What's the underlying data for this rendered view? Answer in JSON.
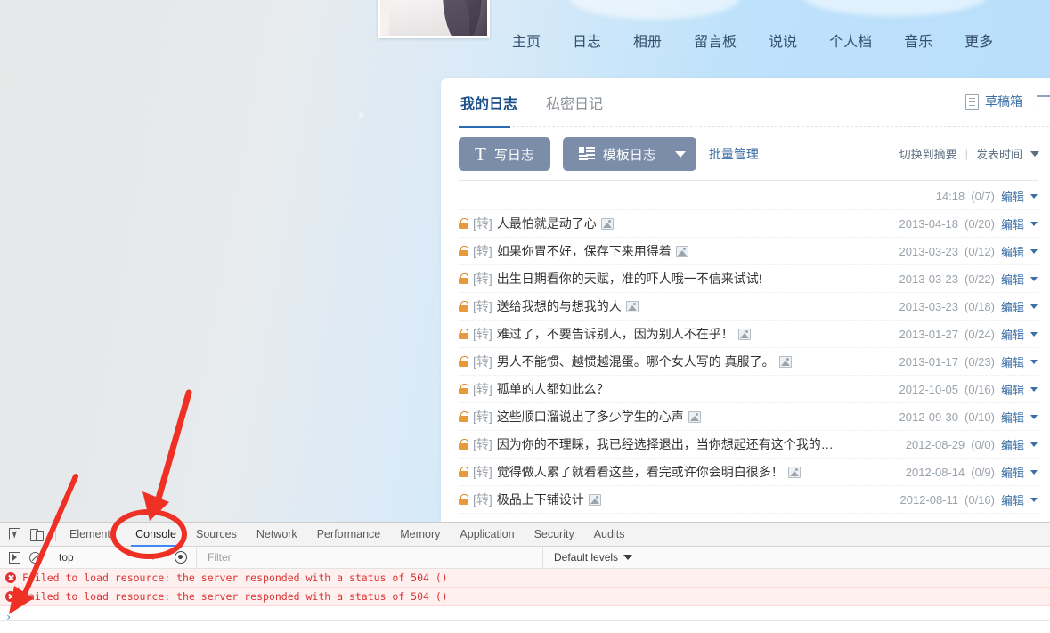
{
  "site": {
    "nav": [
      {
        "label": "主页",
        "name": "nav-home"
      },
      {
        "label": "日志",
        "name": "nav-blog"
      },
      {
        "label": "相册",
        "name": "nav-album"
      },
      {
        "label": "留言板",
        "name": "nav-guestbook"
      },
      {
        "label": "说说",
        "name": "nav-shuoshuo"
      },
      {
        "label": "个人档",
        "name": "nav-profile"
      },
      {
        "label": "音乐",
        "name": "nav-music"
      },
      {
        "label": "更多",
        "name": "nav-more"
      }
    ]
  },
  "panel": {
    "tabs": [
      {
        "label": "我的日志",
        "active": true
      },
      {
        "label": "私密日记",
        "active": false
      }
    ],
    "draft_label": "草稿箱",
    "write_button": "写日志",
    "template_button": "模板日志",
    "batch_button": "批量管理",
    "switch_summary": "切换到摘要",
    "sort_label": "发表时间",
    "separator": "|"
  },
  "list": {
    "tag": "[转]",
    "edit_label": "编辑",
    "first_row": {
      "time": "14:18",
      "count": "(0/7)",
      "edit": "编辑"
    },
    "entries": [
      {
        "title": "人最怕就是动了心",
        "has_image": true,
        "date": "2013-04-18",
        "count": "(0/20)",
        "edit": "编辑"
      },
      {
        "title": "如果你胃不好，保存下来用得着",
        "has_image": true,
        "date": "2013-03-23",
        "count": "(0/12)",
        "edit": "编辑"
      },
      {
        "title": "出生日期看你的天赋，准的吓人哦一不信来试试!",
        "has_image": false,
        "date": "2013-03-23",
        "count": "(0/22)",
        "edit": "编辑"
      },
      {
        "title": "送给我想的与想我的人",
        "has_image": true,
        "date": "2013-03-23",
        "count": "(0/18)",
        "edit": "编辑"
      },
      {
        "title": "难过了，不要告诉别人，因为别人不在乎！",
        "has_image": true,
        "date": "2013-01-27",
        "count": "(0/24)",
        "edit": "编辑"
      },
      {
        "title": "男人不能惯、越惯越混蛋。哪个女人写的 真服了。",
        "has_image": true,
        "date": "2013-01-17",
        "count": "(0/23)",
        "edit": "编辑"
      },
      {
        "title": "孤单的人都如此么？",
        "has_image": false,
        "date": "2012-10-05",
        "count": "(0/16)",
        "edit": "编辑"
      },
      {
        "title": "这些顺口溜说出了多少学生的心声",
        "has_image": true,
        "date": "2012-09-30",
        "count": "(0/10)",
        "edit": "编辑"
      },
      {
        "title": "因为你的不理睬，我已经选择退出，当你想起还有这个我的…",
        "has_image": false,
        "date": "2012-08-29",
        "count": "(0/0)",
        "edit": "编辑"
      },
      {
        "title": "觉得做人累了就看看这些，看完或许你会明白很多！",
        "has_image": true,
        "date": "2012-08-14",
        "count": "(0/9)",
        "edit": "编辑"
      },
      {
        "title": "极品上下铺设计",
        "has_image": true,
        "date": "2012-08-11",
        "count": "(0/16)",
        "edit": "编辑"
      }
    ]
  },
  "devtools": {
    "tabs": [
      {
        "label": "Elements",
        "active": false
      },
      {
        "label": "Console",
        "active": true
      },
      {
        "label": "Sources",
        "active": false
      },
      {
        "label": "Network",
        "active": false
      },
      {
        "label": "Performance",
        "active": false
      },
      {
        "label": "Memory",
        "active": false
      },
      {
        "label": "Application",
        "active": false
      },
      {
        "label": "Security",
        "active": false
      },
      {
        "label": "Audits",
        "active": false
      }
    ],
    "context": "top",
    "filter_placeholder": "Filter",
    "levels_label": "Default levels",
    "messages": [
      "Failed to load resource: the server responded with a status of 504 ()",
      "Failed to load resource: the server responded with a status of 504 ()"
    ],
    "prompt": "›"
  },
  "colors": {
    "accent_blue": "#2a6bb3",
    "link_blue": "#3a6ea5",
    "button_slate": "#7b8da8",
    "annotation_red": "#ee3124",
    "devtools_active": "#4285f4",
    "error_red": "#d83434",
    "lock_orange": "#e79a3c"
  }
}
